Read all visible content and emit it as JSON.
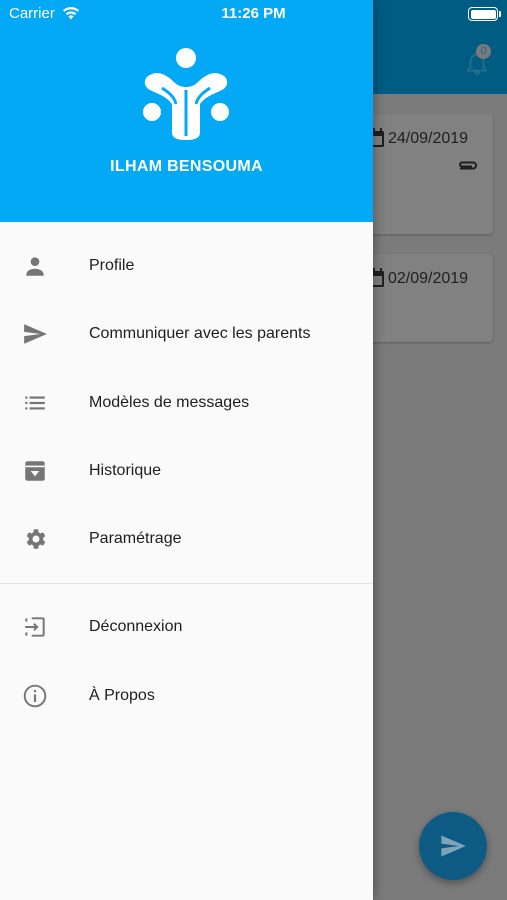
{
  "status_bar": {
    "carrier": "Carrier",
    "time": "11:26 PM"
  },
  "background": {
    "notification_count": "0",
    "cards": [
      {
        "date": "24/09/2019",
        "has_attachment": true
      },
      {
        "date": "02/09/2019",
        "has_attachment": false
      }
    ]
  },
  "drawer": {
    "user_name": "ILHAM BENSOUMA",
    "header_color": "#03a9f4",
    "menu_items": [
      {
        "label": "Profile",
        "icon": "person-icon"
      },
      {
        "label": "Communiquer avec les parents",
        "icon": "send-icon"
      },
      {
        "label": "Modèles de messages",
        "icon": "list-icon"
      },
      {
        "label": "Historique",
        "icon": "archive-icon"
      },
      {
        "label": "Paramétrage",
        "icon": "settings-icon"
      }
    ],
    "secondary_items": [
      {
        "label": "Déconnexion",
        "icon": "logout-icon"
      },
      {
        "label": "À Propos",
        "icon": "info-icon"
      }
    ]
  }
}
